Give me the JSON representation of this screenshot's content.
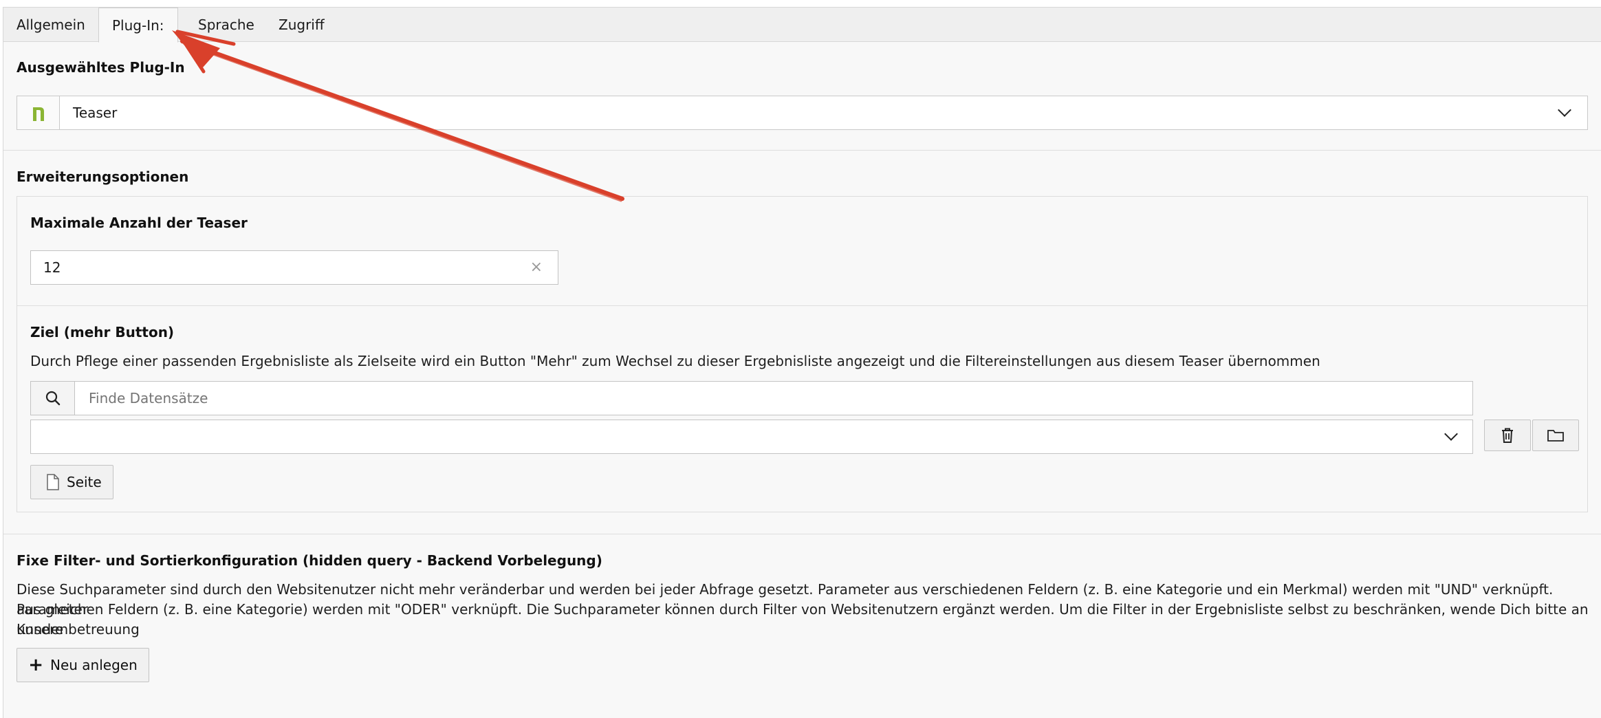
{
  "tabs": [
    {
      "label": "Allgemein",
      "active": false
    },
    {
      "label": "Plug-In:",
      "active": true
    },
    {
      "label": "Sprache",
      "active": false
    },
    {
      "label": "Zugriff",
      "active": false
    }
  ],
  "plugin": {
    "title": "Ausgewähltes Plug-In",
    "selected": "Teaser",
    "icon": "plugin-n-icon",
    "icon_color": "#8bb534"
  },
  "extension": {
    "title": "Erweiterungsoptionen",
    "max_label": "Maximale Anzahl der Teaser",
    "max_value": "12",
    "target_label": "Ziel (mehr Button)",
    "target_desc": "Durch Pflege einer passenden Ergebnisliste als Zielseite wird ein Button \"Mehr\" zum Wechsel zu dieser Ergebnisliste angezeigt und die Filtereinstellungen aus diesem Teaser übernommen",
    "search_placeholder": "Finde Datensätze",
    "select_value": "",
    "page_button": "Seite"
  },
  "filters": {
    "title": "Fixe Filter- und Sortierkonfiguration (hidden query - Backend Vorbelegung)",
    "desc_line1": "Diese Suchparameter sind durch den Websitenutzer nicht mehr veränderbar und werden bei jeder Abfrage gesetzt. Parameter aus verschiedenen Feldern (z. B. eine Kategorie und ein Merkmal) werden mit \"UND\" verknüpft. Parameter",
    "desc_line2": "aus gleichen Feldern (z. B. eine Kategorie) werden mit \"ODER\" verknüpft. Die Suchparameter können durch Filter von Websitenutzern ergänzt werden. Um die Filter in der Ergebnisliste selbst zu beschränken, wende Dich bitte an unsere",
    "desc_line3": "Kundenbetreuung",
    "new_button": "Neu anlegen"
  },
  "annotation_color": "#d9402b"
}
